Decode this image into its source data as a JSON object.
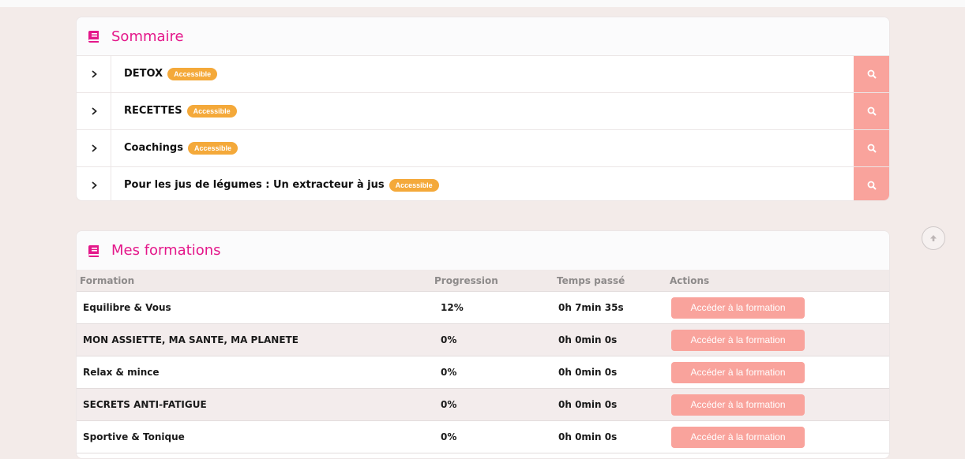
{
  "colors": {
    "accent": "#e4178a",
    "badge": "#f4a93a",
    "button": "#f9a39c"
  },
  "sommaire": {
    "title": "Sommaire",
    "icon": "book-icon",
    "items": [
      {
        "label": "DETOX",
        "badge": "Accessible"
      },
      {
        "label": "RECETTES",
        "badge": "Accessible"
      },
      {
        "label": "Coachings",
        "badge": "Accessible"
      },
      {
        "label": "Pour les jus de légumes : Un extracteur à jus",
        "badge": "Accessible"
      }
    ]
  },
  "formations": {
    "title": "Mes formations",
    "icon": "book-icon",
    "headers": [
      "Formation",
      "Progression",
      "Temps passé",
      "Actions"
    ],
    "rows": [
      {
        "name": "Equilibre & Vous",
        "progress": "12%",
        "time": "0h 7min 35s",
        "action": "Accéder à la formation"
      },
      {
        "name": "MON ASSIETTE, MA SANTE, MA PLANETE",
        "progress": "0%",
        "time": "0h 0min 0s",
        "action": "Accéder à la formation"
      },
      {
        "name": "Relax & mince",
        "progress": "0%",
        "time": "0h 0min 0s",
        "action": "Accéder à la formation"
      },
      {
        "name": "SECRETS ANTI-FATIGUE",
        "progress": "0%",
        "time": "0h 0min 0s",
        "action": "Accéder à la formation"
      },
      {
        "name": "Sportive & Tonique",
        "progress": "0%",
        "time": "0h 0min 0s",
        "action": "Accéder à la formation"
      }
    ]
  },
  "scroll_top": {
    "icon": "arrow-up-icon"
  }
}
